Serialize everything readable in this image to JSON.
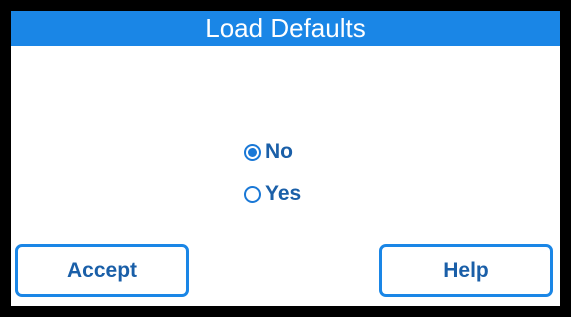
{
  "header": {
    "title": "Load Defaults"
  },
  "options": [
    {
      "label": "No",
      "selected": true
    },
    {
      "label": "Yes",
      "selected": false
    }
  ],
  "buttons": {
    "accept_label": "Accept",
    "help_label": "Help"
  },
  "colors": {
    "accent": "#1a86e6",
    "text": "#1a5fa8",
    "bezel": "#000000",
    "background": "#ffffff"
  }
}
